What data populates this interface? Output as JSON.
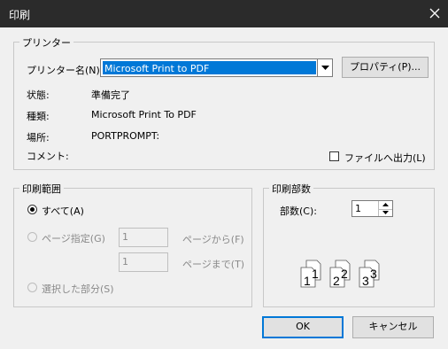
{
  "window": {
    "title": "印刷"
  },
  "printer": {
    "group_label": "プリンター",
    "name_label": "プリンター名(N):",
    "name_value": "Microsoft Print to PDF",
    "properties_button": "プロパティ(P)...",
    "status_label": "状態:",
    "status_value": "準備完了",
    "type_label": "種類:",
    "type_value": "Microsoft Print To PDF",
    "where_label": "場所:",
    "where_value": "PORTPROMPT:",
    "comment_label": "コメント:",
    "print_to_file_label": "ファイルへ出力(L)"
  },
  "print_range": {
    "group_label": "印刷範囲",
    "all_label": "すべて(A)",
    "pages_label": "ページ指定(G)",
    "from_value": "1",
    "from_suffix": "ページから(F)",
    "to_value": "1",
    "to_suffix": "ページまで(T)",
    "selection_label": "選択した部分(S)"
  },
  "copies": {
    "group_label": "印刷部数",
    "count_label": "部数(C):",
    "count_value": "1",
    "collate_numbers": [
      "1",
      "1",
      "2",
      "2",
      "3",
      "3"
    ]
  },
  "buttons": {
    "ok": "OK",
    "cancel": "キャンセル"
  }
}
